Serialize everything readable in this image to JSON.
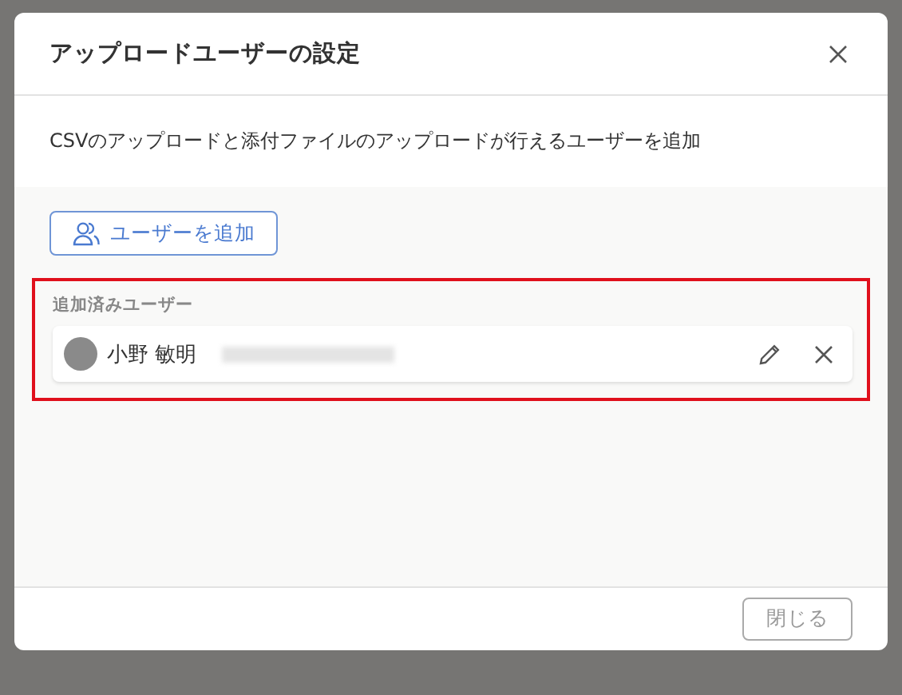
{
  "dialog": {
    "title": "アップロードユーザーの設定",
    "description": "CSVのアップロードと添付ファイルのアップロードが行えるユーザーを追加"
  },
  "add_button": {
    "label": "ユーザーを追加"
  },
  "added_users": {
    "heading": "追加済みユーザー",
    "highlighted": true,
    "users": [
      {
        "name": "小野 敏明",
        "email_redacted": true
      }
    ]
  },
  "footer": {
    "close_button": {
      "label": "閉じる",
      "disabled": true
    }
  }
}
